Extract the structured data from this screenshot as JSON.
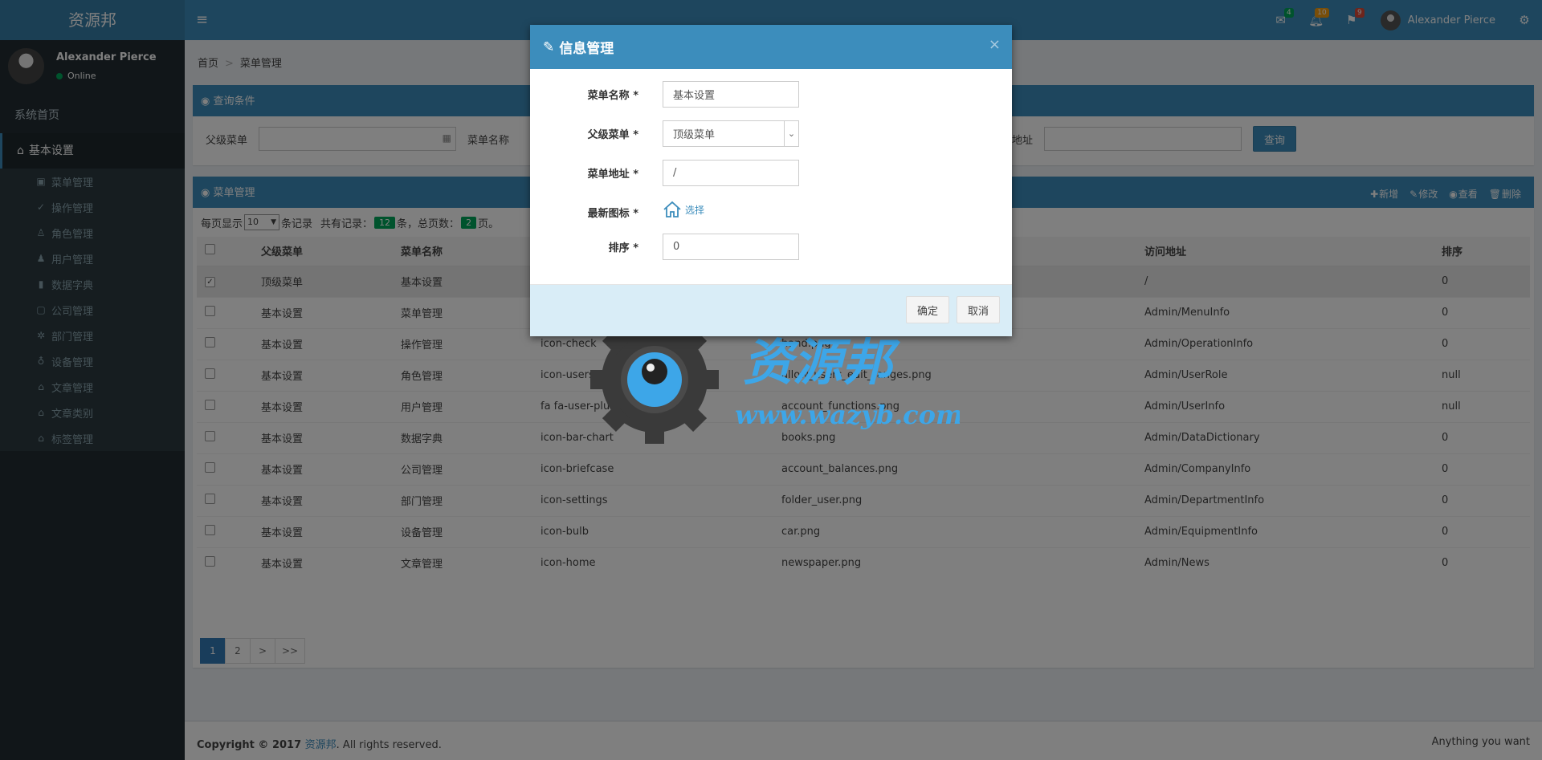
{
  "brand": "资源邦",
  "header": {
    "toggle": "≡",
    "mail_count": "4",
    "bell_count": "10",
    "flag_count": "9",
    "user_name": "Alexander Pierce",
    "colors": {
      "primary": "#3c8dbc",
      "dark": "#222d32",
      "green": "#00a65a",
      "orange": "#f39c12",
      "red": "#dd4b39"
    }
  },
  "sidebar": {
    "user_name": "Alexander Pierce",
    "status": "Online",
    "home": "系统首页",
    "group": "基本设置",
    "items": [
      {
        "icon": "list-icon",
        "glyph": "▣",
        "label": "菜单管理"
      },
      {
        "icon": "check-circle-icon",
        "glyph": "✓",
        "label": "操作管理"
      },
      {
        "icon": "users-icon",
        "glyph": "♙",
        "label": "角色管理"
      },
      {
        "icon": "user-plus-icon",
        "glyph": "♟",
        "label": "用户管理"
      },
      {
        "icon": "bar-chart-icon",
        "glyph": "▮",
        "label": "数据字典"
      },
      {
        "icon": "briefcase-icon",
        "glyph": "▢",
        "label": "公司管理"
      },
      {
        "icon": "settings-icon",
        "glyph": "✲",
        "label": "部门管理"
      },
      {
        "icon": "bulb-icon",
        "glyph": "♁",
        "label": "设备管理"
      },
      {
        "icon": "home-icon",
        "glyph": "⌂",
        "label": "文章管理"
      },
      {
        "icon": "home-icon",
        "glyph": "⌂",
        "label": "文章类别"
      },
      {
        "icon": "home-icon",
        "glyph": "⌂",
        "label": "标签管理"
      }
    ]
  },
  "breadcrumb": {
    "home": "首页",
    "sep": ">",
    "current": "菜单管理"
  },
  "query": {
    "title": "查询条件",
    "parent_label": "父级菜单",
    "name_label": "菜单名称",
    "url_label": "问地址",
    "button": "查询"
  },
  "table_box": {
    "title": "菜单管理",
    "actions": {
      "add": "新增",
      "edit": "修改",
      "view": "查看",
      "delete": "删除"
    },
    "per_page_prefix": "每页显示",
    "per_page_value": "10",
    "per_page_suffix": "条记录",
    "total_prefix": "共有记录：",
    "total": "12",
    "total_suffix": "条，总页数：",
    "pages": "2",
    "pages_suffix": "页。",
    "columns": [
      "父级菜单",
      "菜单名称",
      "",
      "",
      "访问地址",
      "排序"
    ],
    "rows": [
      {
        "parent": "顶级菜单",
        "name": "基本设置",
        "icon": "",
        "image": "",
        "url": "/",
        "sort": "0",
        "checked": true
      },
      {
        "parent": "基本设置",
        "name": "菜单管理",
        "icon": "",
        "image": "",
        "url": "Admin/MenuInfo",
        "sort": "0",
        "checked": false
      },
      {
        "parent": "基本设置",
        "name": "操作管理",
        "icon": "icon-check",
        "image": "hand.png",
        "url": "Admin/OperationInfo",
        "sort": "0",
        "checked": false
      },
      {
        "parent": "基本设置",
        "name": "角色管理",
        "icon": "icon-users",
        "image": "allow_users_edit_ranges.png",
        "url": "Admin/UserRole",
        "sort": "null",
        "checked": false
      },
      {
        "parent": "基本设置",
        "name": "用户管理",
        "icon": "fa fa-user-plus",
        "image": "account_functions.png",
        "url": "Admin/UserInfo",
        "sort": "null",
        "checked": false
      },
      {
        "parent": "基本设置",
        "name": "数据字典",
        "icon": "icon-bar-chart",
        "image": "books.png",
        "url": "Admin/DataDictionary",
        "sort": "0",
        "checked": false
      },
      {
        "parent": "基本设置",
        "name": "公司管理",
        "icon": "icon-briefcase",
        "image": "account_balances.png",
        "url": "Admin/CompanyInfo",
        "sort": "0",
        "checked": false
      },
      {
        "parent": "基本设置",
        "name": "部门管理",
        "icon": "icon-settings",
        "image": "folder_user.png",
        "url": "Admin/DepartmentInfo",
        "sort": "0",
        "checked": false
      },
      {
        "parent": "基本设置",
        "name": "设备管理",
        "icon": "icon-bulb",
        "image": "car.png",
        "url": "Admin/EquipmentInfo",
        "sort": "0",
        "checked": false
      },
      {
        "parent": "基本设置",
        "name": "文章管理",
        "icon": "icon-home",
        "image": "newspaper.png",
        "url": "Admin/News",
        "sort": "0",
        "checked": false
      }
    ],
    "pagination": [
      "1",
      "2",
      ">",
      ">>"
    ]
  },
  "footer": {
    "prefix": "Copyright © 2017 ",
    "link": "资源邦",
    "suffix": ". All rights reserved.",
    "right": "Anything you want"
  },
  "modal": {
    "title": "信息管理",
    "close": "×",
    "fields": {
      "name_label": "菜单名称 *",
      "name_value": "基本设置",
      "parent_label": "父级菜单 *",
      "parent_value": "顶级菜单",
      "url_label": "菜单地址 *",
      "url_value": "/",
      "icon_label": "最新图标 *",
      "icon_choose": "选择",
      "sort_label": "排序 *",
      "sort_value": "0"
    },
    "ok": "确定",
    "cancel": "取消"
  },
  "watermark": {
    "title": "资源邦",
    "url": "www.wazyb.com"
  }
}
